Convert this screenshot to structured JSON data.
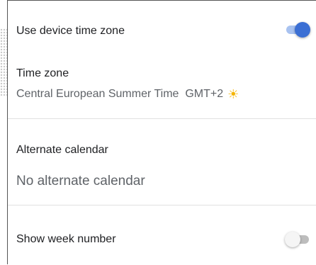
{
  "settings": {
    "device_tz": {
      "label": "Use device time zone",
      "enabled": true
    },
    "time_zone": {
      "label": "Time zone",
      "value": "Central European Summer Time  GMT+2",
      "icon": "sun-icon"
    },
    "alt_calendar": {
      "label": "Alternate calendar",
      "value": "No alternate calendar"
    },
    "week_number": {
      "label": "Show week number",
      "enabled": false
    }
  },
  "colors": {
    "accent": "#3b6fd4",
    "accent_track": "#a8c2f0",
    "sun": "#f4b400"
  }
}
